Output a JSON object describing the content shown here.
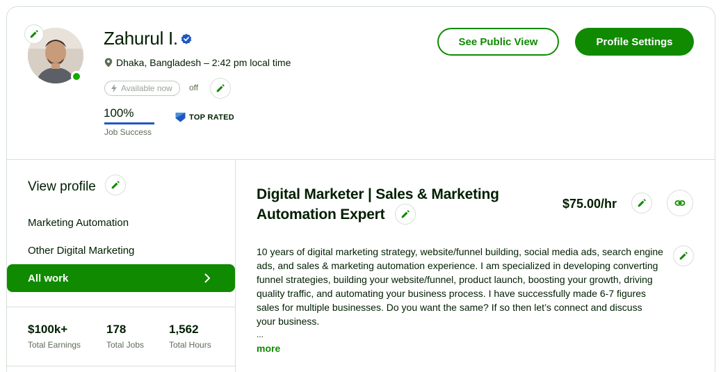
{
  "profile": {
    "name": "Zahurul I.",
    "location": "Dhaka, Bangladesh – 2:42 pm local time",
    "availability_label": "Available now",
    "availability_state": "off",
    "job_success_value": "100%",
    "job_success_label": "Job Success",
    "badge": "TOP RATED"
  },
  "actions": {
    "public_view": "See Public View",
    "settings": "Profile Settings"
  },
  "sidebar": {
    "view_profile": "View profile",
    "items": [
      {
        "label": "Marketing Automation"
      },
      {
        "label": "Other Digital Marketing"
      },
      {
        "label": "All work",
        "active": true
      }
    ],
    "stats": [
      {
        "value": "$100k+",
        "label": "Total Earnings"
      },
      {
        "value": "178",
        "label": "Total Jobs"
      },
      {
        "value": "1,562",
        "label": "Total Hours"
      }
    ]
  },
  "main": {
    "title_line1": "Digital Marketer | Sales & Marketing",
    "title_line2": "Automation Expert",
    "rate": "$75.00/hr",
    "description": "10 years of digital marketing strategy, website/funnel building, social media ads, search engine ads, and sales & marketing automation experience. I am specialized in developing converting funnel strategies, building your website/funnel, product launch, boosting your growth, driving quality traffic, and automating your business process. I have successfully made 6-7 figures sales for multiple businesses. Do you want the same? If so then let’s connect and discuss your business.",
    "ellipsis": "...",
    "more": "more"
  },
  "colors": {
    "brand_green": "#108a00",
    "online_green": "#14a800",
    "jss_blue": "#1f57c3",
    "border": "#d5e0d5",
    "text": "#001e00",
    "muted": "#5e6d55"
  },
  "icons": [
    "pencil-icon",
    "verified-badge-icon",
    "location-pin-icon",
    "lightning-icon",
    "top-rated-badge-icon",
    "chevron-right-icon",
    "link-icon"
  ]
}
